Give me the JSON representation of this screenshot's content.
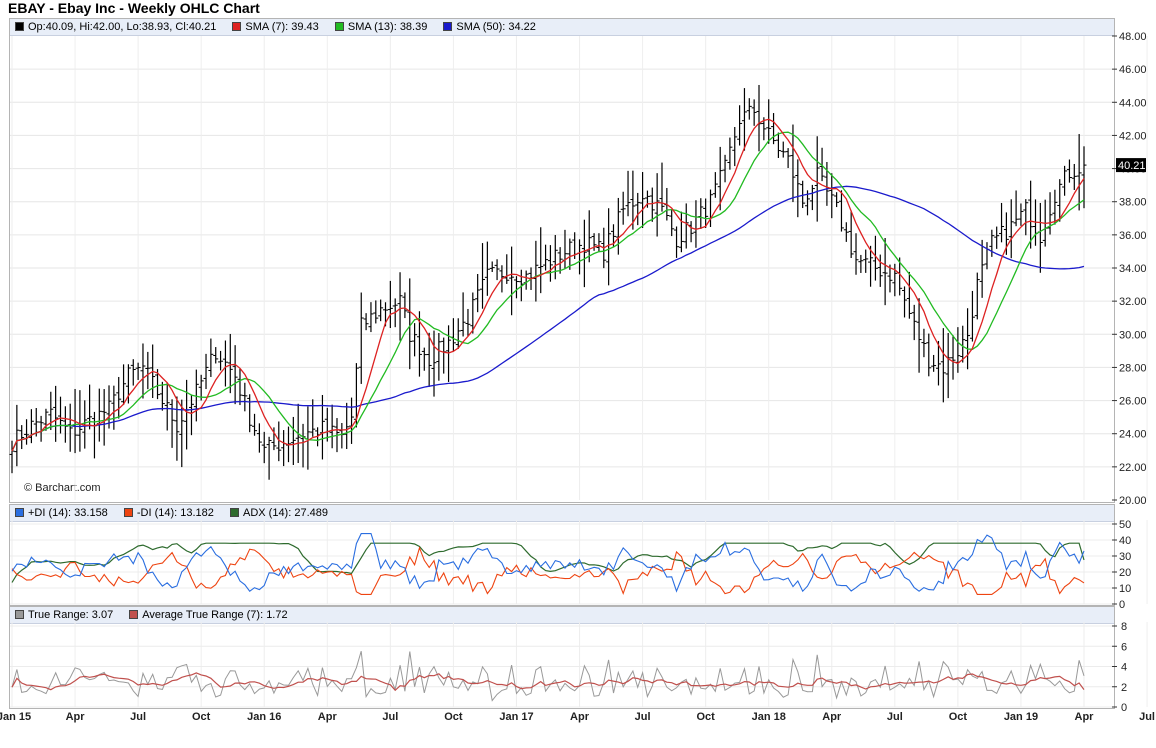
{
  "title": "EBAY - Ebay Inc - Weekly OHLC Chart",
  "credit": "© Barchart.com",
  "colors": {
    "sma7": "#dd2222",
    "sma13": "#22bb22",
    "sma50": "#1a1acc",
    "bars": "#000000",
    "pdi": "#2a6ee0",
    "mdi": "#ee4411",
    "adx": "#2e6b2e",
    "tr": "#999999",
    "atr": "#c0504d"
  },
  "legends": {
    "price": [
      {
        "color": "#000000",
        "label": "Op:40.09, Hi:42.00, Lo:38.93, Cl:40.21"
      },
      {
        "color": "#dd2222",
        "label": "SMA (7): 39.43"
      },
      {
        "color": "#22bb22",
        "label": "SMA (13): 38.39"
      },
      {
        "color": "#1a1acc",
        "label": "SMA (50): 34.22"
      }
    ],
    "dmi": [
      {
        "color": "#2a6ee0",
        "label": "+DI (14): 33.158"
      },
      {
        "color": "#ee4411",
        "label": "-DI (14): 13.182"
      },
      {
        "color": "#2e6b2e",
        "label": "ADX (14): 27.489"
      }
    ],
    "tr": [
      {
        "color": "#999999",
        "label": "True Range: 3.07"
      },
      {
        "color": "#c0504d",
        "label": "Average True Range (7): 1.72"
      }
    ]
  },
  "chart_data": {
    "type": "line",
    "x_labels": [
      "Jan 15",
      "Apr",
      "Jul",
      "Oct",
      "Jan 16",
      "Apr",
      "Jul",
      "Oct",
      "Jan 17",
      "Apr",
      "Jul",
      "Oct",
      "Jan 18",
      "Apr",
      "Jul",
      "Oct",
      "Jan 19",
      "Apr",
      "Jul"
    ],
    "price_axis": {
      "ylim": [
        20,
        48
      ],
      "ticks": [
        "20.00",
        "22.00",
        "24.00",
        "26.00",
        "28.00",
        "30.00",
        "32.00",
        "34.00",
        "36.00",
        "38.00",
        "40.00",
        "42.00",
        "44.00",
        "46.00",
        "48.00"
      ],
      "last_close_label": "40.21",
      "last_close": 40.21
    },
    "dmi_axis": {
      "ylim": [
        0,
        50
      ],
      "ticks": [
        "0",
        "10",
        "20",
        "30",
        "40",
        "50"
      ]
    },
    "tr_axis": {
      "ylim": [
        0,
        8
      ],
      "ticks": [
        "0",
        "2",
        "4",
        "6",
        "8"
      ]
    },
    "close_anchors": [
      [
        0,
        23.5
      ],
      [
        4,
        24.5
      ],
      [
        8,
        25.2
      ],
      [
        12,
        24.0
      ],
      [
        16,
        24.8
      ],
      [
        20,
        25.5
      ],
      [
        24,
        27.5
      ],
      [
        27,
        28.0
      ],
      [
        30,
        26.5
      ],
      [
        34,
        24.5
      ],
      [
        38,
        26.5
      ],
      [
        42,
        29.0
      ],
      [
        46,
        27.5
      ],
      [
        49,
        25.0
      ],
      [
        52,
        23.0
      ],
      [
        56,
        23.5
      ],
      [
        60,
        24.0
      ],
      [
        64,
        24.3
      ],
      [
        68,
        23.8
      ],
      [
        70,
        25.0
      ],
      [
        72,
        30.5
      ],
      [
        76,
        31.5
      ],
      [
        80,
        32.0
      ],
      [
        82,
        30.0
      ],
      [
        86,
        28.5
      ],
      [
        90,
        29.5
      ],
      [
        94,
        31.0
      ],
      [
        98,
        33.5
      ],
      [
        102,
        33.8
      ],
      [
        106,
        33.5
      ],
      [
        110,
        34.3
      ],
      [
        114,
        35.0
      ],
      [
        118,
        35.5
      ],
      [
        122,
        35.0
      ],
      [
        126,
        37.5
      ],
      [
        130,
        38.5
      ],
      [
        134,
        37.5
      ],
      [
        137,
        35.8
      ],
      [
        140,
        36.5
      ],
      [
        144,
        38.0
      ],
      [
        147,
        40.0
      ],
      [
        150,
        43.0
      ],
      [
        153,
        43.5
      ],
      [
        156,
        42.0
      ],
      [
        160,
        40.5
      ],
      [
        163,
        38.0
      ],
      [
        166,
        39.5
      ],
      [
        170,
        37.5
      ],
      [
        174,
        34.5
      ],
      [
        178,
        34.0
      ],
      [
        182,
        33.5
      ],
      [
        186,
        30.5
      ],
      [
        189,
        28.5
      ],
      [
        192,
        28.0
      ],
      [
        195,
        29.0
      ],
      [
        197,
        30.0
      ],
      [
        199,
        33.0
      ],
      [
        202,
        35.5
      ],
      [
        206,
        36.5
      ],
      [
        209,
        37.5
      ],
      [
        212,
        36.0
      ],
      [
        215,
        38.5
      ],
      [
        218,
        39.8
      ],
      [
        221,
        40.2
      ]
    ],
    "series": [
      {
        "name": "SMA (7)",
        "last": 39.43
      },
      {
        "name": "SMA (13)",
        "last": 38.39
      },
      {
        "name": "SMA (50)",
        "last": 34.22
      },
      {
        "name": "+DI (14)",
        "last": 33.158
      },
      {
        "name": "-DI (14)",
        "last": 13.182
      },
      {
        "name": "ADX (14)",
        "last": 27.489
      },
      {
        "name": "True Range",
        "last": 3.07
      },
      {
        "name": "Average True Range (7)",
        "last": 1.72
      }
    ],
    "weeks": 222
  }
}
